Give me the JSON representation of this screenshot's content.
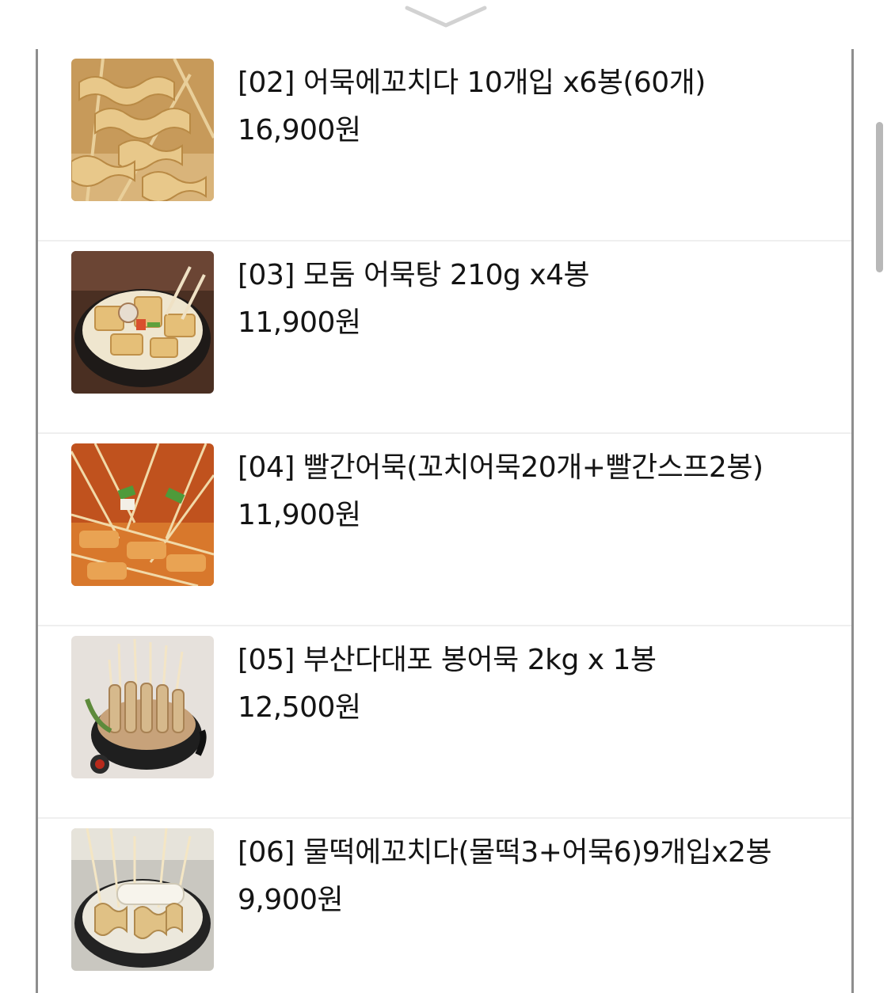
{
  "products": [
    {
      "name": "[02] 어묵에꼬치다 10개입 x6봉(60개)",
      "price": "16,900원",
      "image": "fish-cake-skewers-photo"
    },
    {
      "name": "[03] 모둠 어묵탕 210g x4봉",
      "price": "11,900원",
      "image": "fish-cake-soup-pot-photo"
    },
    {
      "name": "[04] 빨간어묵(꼬치어묵20개+빨간스프2봉)",
      "price": "11,900원",
      "image": "spicy-fish-cake-skewers-photo"
    },
    {
      "name": "[05] 부산다대포 봉어묵 2kg x 1봉",
      "price": "12,500원",
      "image": "stick-fish-cake-bowl-photo"
    },
    {
      "name": "[06] 물떡에꼬치다(물떡3+어묵6)9개입x2봉",
      "price": "9,900원",
      "image": "rice-cake-fish-cake-pot-photo"
    }
  ],
  "icons": {
    "collapse": "chevron-down-icon"
  },
  "colors": {
    "border": "#8e8e8e",
    "divider": "#efefef",
    "scrollbar": "#b8b8b8",
    "text": "#141414"
  }
}
